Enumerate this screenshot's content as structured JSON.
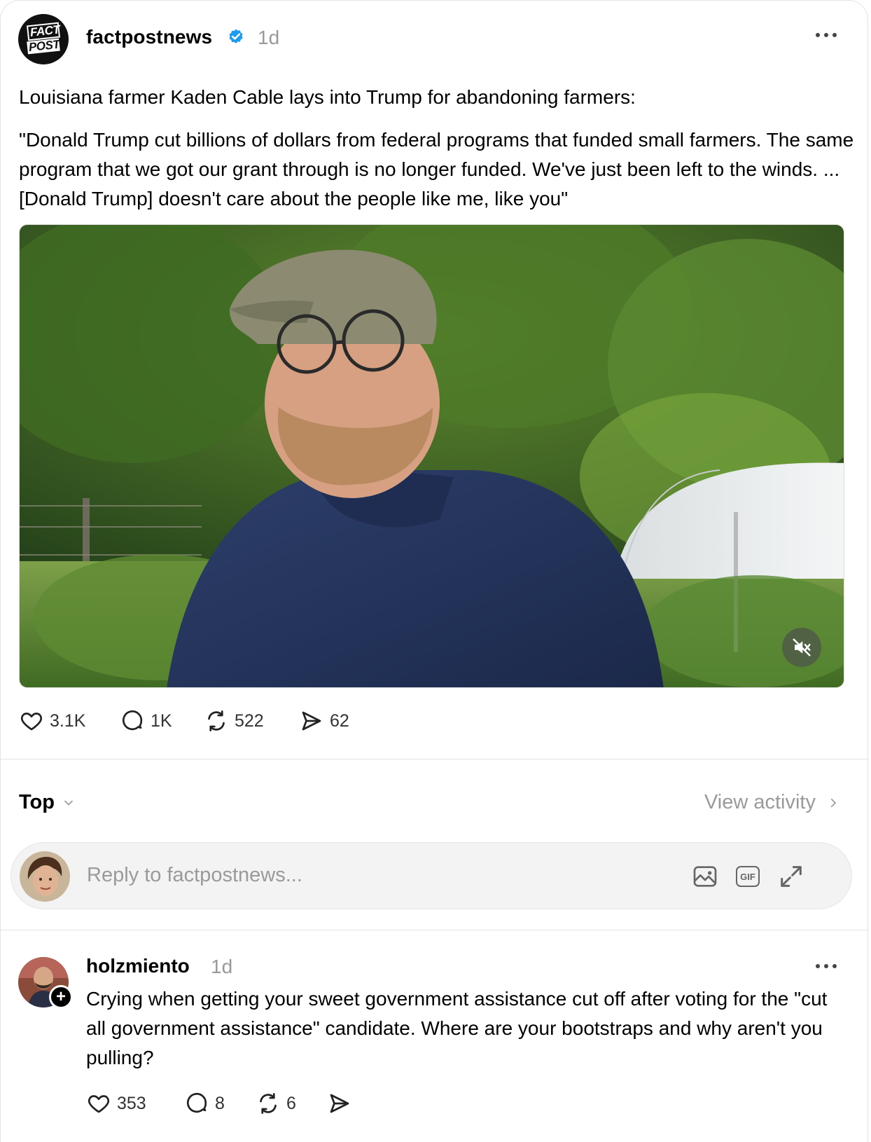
{
  "post": {
    "author": "factpostnews",
    "avatar_logo": {
      "line1": "FACT",
      "line2": "POST"
    },
    "verified_icon": "verified-badge-icon",
    "time": "1d",
    "headline": "Louisiana farmer Kaden Cable lays into Trump for abandoning farmers:",
    "quote": "\"Donald Trump cut billions of dollars from federal programs that funded small farmers. The same program that we got our grant through is no longer funded. We've just been left to the winds. ... [Donald Trump] doesn't care about the people like me, like you\"",
    "media": {
      "type": "video",
      "muted": true,
      "mute_icon": "speaker-muted-icon"
    },
    "stats": {
      "likes": "3.1K",
      "comments": "1K",
      "reposts": "522",
      "shares": "62"
    }
  },
  "replies_header": {
    "sort_label": "Top",
    "view_activity": "View activity"
  },
  "reply_box": {
    "placeholder": "Reply to factpostnews...",
    "icons": [
      "image-icon",
      "gif-icon",
      "expand-icon"
    ],
    "gif_label": "GIF"
  },
  "comment": {
    "author": "holzmiento",
    "time": "1d",
    "text": "Crying when getting your sweet government assistance cut off after voting for the \"cut all government assistance\" candidate. Where are your bootstraps and why aren't you pulling?",
    "follow_symbol": "+",
    "stats": {
      "likes": "353",
      "comments": "8",
      "reposts": "6"
    }
  },
  "colors": {
    "text": "#000000",
    "muted": "#999999",
    "verified": "#1d9bf0",
    "divider": "#e3e3e3",
    "reply_bg": "#f3f3f3"
  }
}
